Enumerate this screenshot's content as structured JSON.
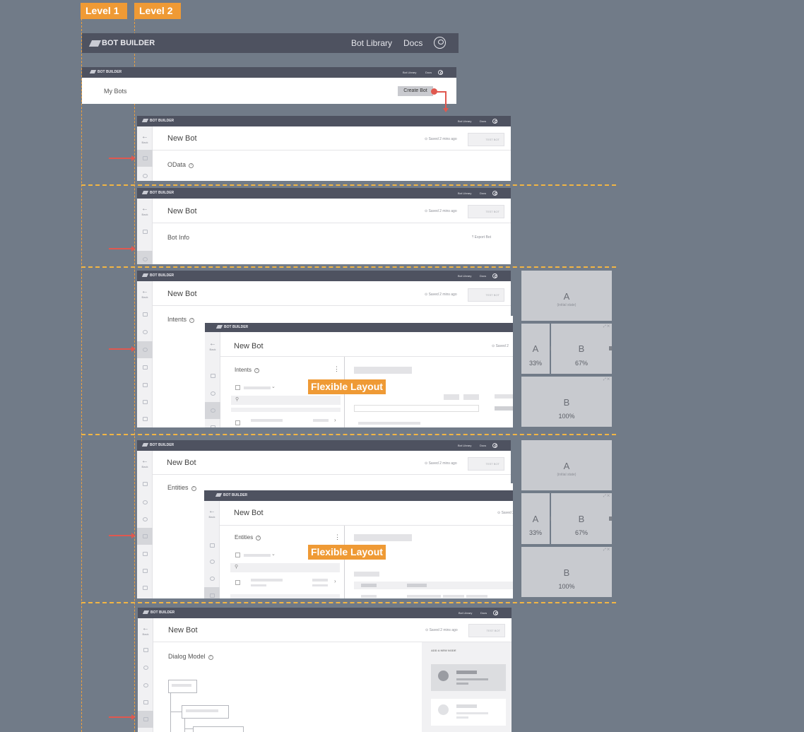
{
  "levels": {
    "level1": "Level 1",
    "level2": "Level 2"
  },
  "app": {
    "logo": "BOT BUILDER",
    "nav_library": "Bot Library",
    "nav_docs": "Docs",
    "my_bots": "My Bots",
    "create_bot": "Create Bot",
    "back": "Back",
    "bot_title": "New Bot",
    "saved": "Saved 2 mins ago",
    "test_bot": "TEST BOT",
    "export_bot": "Export Bot",
    "saved_short": "Saved 2"
  },
  "screens": {
    "odata": "OData",
    "bot_info": "Bot Info",
    "intents": "Intents",
    "entities": "Entities",
    "dialog_model": "Dialog Model",
    "add_node": "ADD A NEW NODE"
  },
  "flexible_layout": "Flexible Layout",
  "layout_states": {
    "a_label": "A",
    "b_label": "B",
    "initial_state": "(initial state)",
    "pct_33": "33%",
    "pct_67": "67%",
    "pct_100": "100%"
  },
  "colors": {
    "accent": "#ef9a35",
    "header": "#4e5260",
    "background": "#717b88",
    "arrow": "#e0584f"
  }
}
